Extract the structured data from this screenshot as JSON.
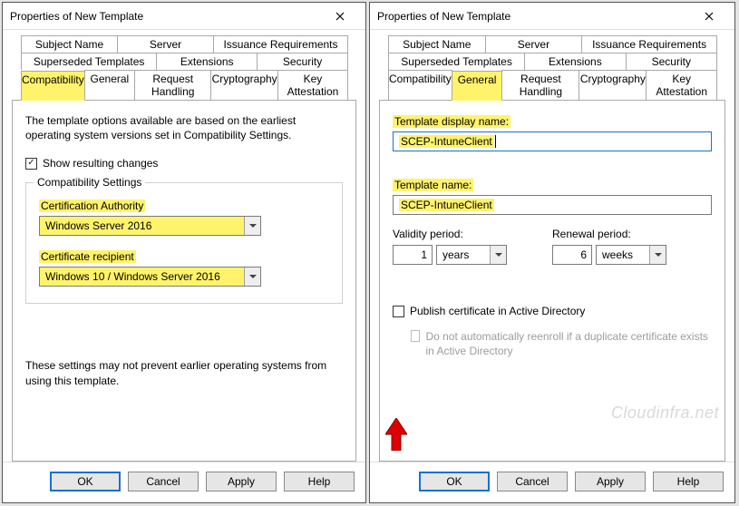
{
  "left": {
    "title": "Properties of New Template",
    "tabs_row1": [
      "Subject Name",
      "Server",
      "Issuance Requirements"
    ],
    "tabs_row2": [
      "Superseded Templates",
      "Extensions",
      "Security"
    ],
    "tabs_row3": [
      "Compatibility",
      "General",
      "Request Handling",
      "Cryptography",
      "Key Attestation"
    ],
    "selected_tab": "Compatibility",
    "info_text": "The template options available are based on the earliest operating system versions set in Compatibility Settings.",
    "show_resulting_changes_label": "Show resulting changes",
    "show_resulting_changes_checked": true,
    "groupbox_legend": "Compatibility Settings",
    "cert_authority_label": "Certification Authority",
    "cert_authority_value": "Windows Server 2016",
    "cert_recipient_label": "Certificate recipient",
    "cert_recipient_value": "Windows 10 / Windows Server 2016",
    "footer_note": "These settings may not prevent earlier operating systems from using this template.",
    "buttons": {
      "ok": "OK",
      "cancel": "Cancel",
      "apply": "Apply",
      "help": "Help"
    }
  },
  "right": {
    "title": "Properties of New Template",
    "tabs_row1": [
      "Subject Name",
      "Server",
      "Issuance Requirements"
    ],
    "tabs_row2": [
      "Superseded Templates",
      "Extensions",
      "Security"
    ],
    "tabs_row3": [
      "Compatibility",
      "General",
      "Request Handling",
      "Cryptography",
      "Key Attestation"
    ],
    "selected_tab": "General",
    "display_name_label": "Template display name:",
    "display_name_value": "SCEP-IntuneClient",
    "template_name_label": "Template name:",
    "template_name_value": "SCEP-IntuneClient",
    "validity_label": "Validity period:",
    "validity_value": "1",
    "validity_unit": "years",
    "renewal_label": "Renewal period:",
    "renewal_value": "6",
    "renewal_unit": "weeks",
    "publish_ad_label": "Publish certificate in Active Directory",
    "publish_ad_checked": false,
    "no_reenroll_label": "Do not automatically reenroll if a duplicate certificate exists in Active Directory",
    "buttons": {
      "ok": "OK",
      "cancel": "Cancel",
      "apply": "Apply",
      "help": "Help"
    },
    "watermark": "Cloudinfra.net"
  }
}
